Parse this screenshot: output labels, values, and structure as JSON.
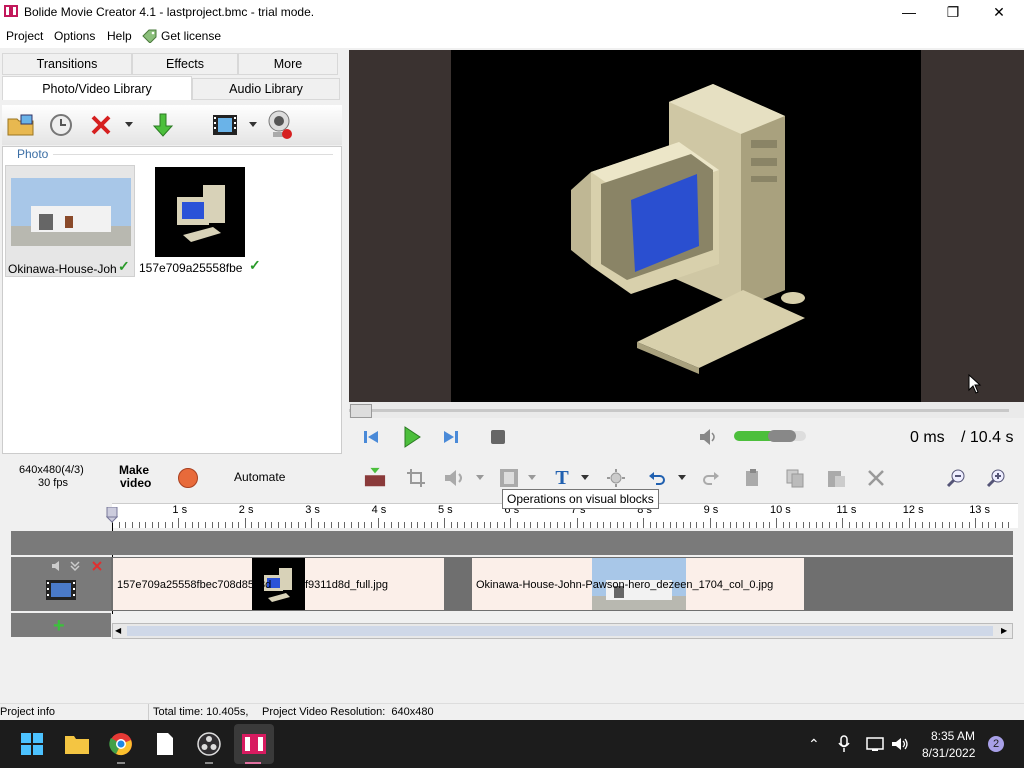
{
  "window": {
    "title": "Bolide Movie Creator 4.1 - lastproject.bmc - trial mode.",
    "minimize": "—",
    "maximize": "❐",
    "close": "✕"
  },
  "menu": {
    "project": "Project",
    "options": "Options",
    "help": "Help",
    "license": "Get license"
  },
  "tabs": {
    "transitions": "Transitions",
    "effects": "Effects",
    "more": "More",
    "photo_video": "Photo/Video Library",
    "audio": "Audio Library"
  },
  "library": {
    "section": "Photo",
    "items": [
      {
        "label": "Okinawa-House-Joh"
      },
      {
        "label": "157e709a25558fbe"
      }
    ]
  },
  "player": {
    "time_current": "0 ms",
    "time_total": "/ 10.4 s",
    "volume_level": 0.8
  },
  "bottom_toolbar": {
    "resolution": "640x480(4/3)",
    "fps": "30 fps",
    "make_video_1": "Make",
    "make_video_2": "video",
    "automate": "Automate",
    "tooltip": "Operations on visual blocks"
  },
  "ruler": [
    "1 s",
    "2 s",
    "3 s",
    "4 s",
    "5 s",
    "6 s",
    "7 s",
    "8 s",
    "9 s",
    "10 s",
    "11 s",
    "12 s",
    "13 s"
  ],
  "clips": {
    "clip1_a": "157e709a25558fbec708d85",
    "clip1_b": "f9311d8d_full.jpg",
    "clip1_mid": "8d",
    "clip2_a": "Okinawa-House-John-Pawson-hero_dezeen_1704_col_0.jpg"
  },
  "status": {
    "project_info": "Project info",
    "total_time": "Total time: 10.405s,",
    "resolution": "Project Video Resolution:  640x480"
  },
  "taskbar": {
    "time": "8:35 AM",
    "date": "8/31/2022",
    "notifications": "2"
  }
}
